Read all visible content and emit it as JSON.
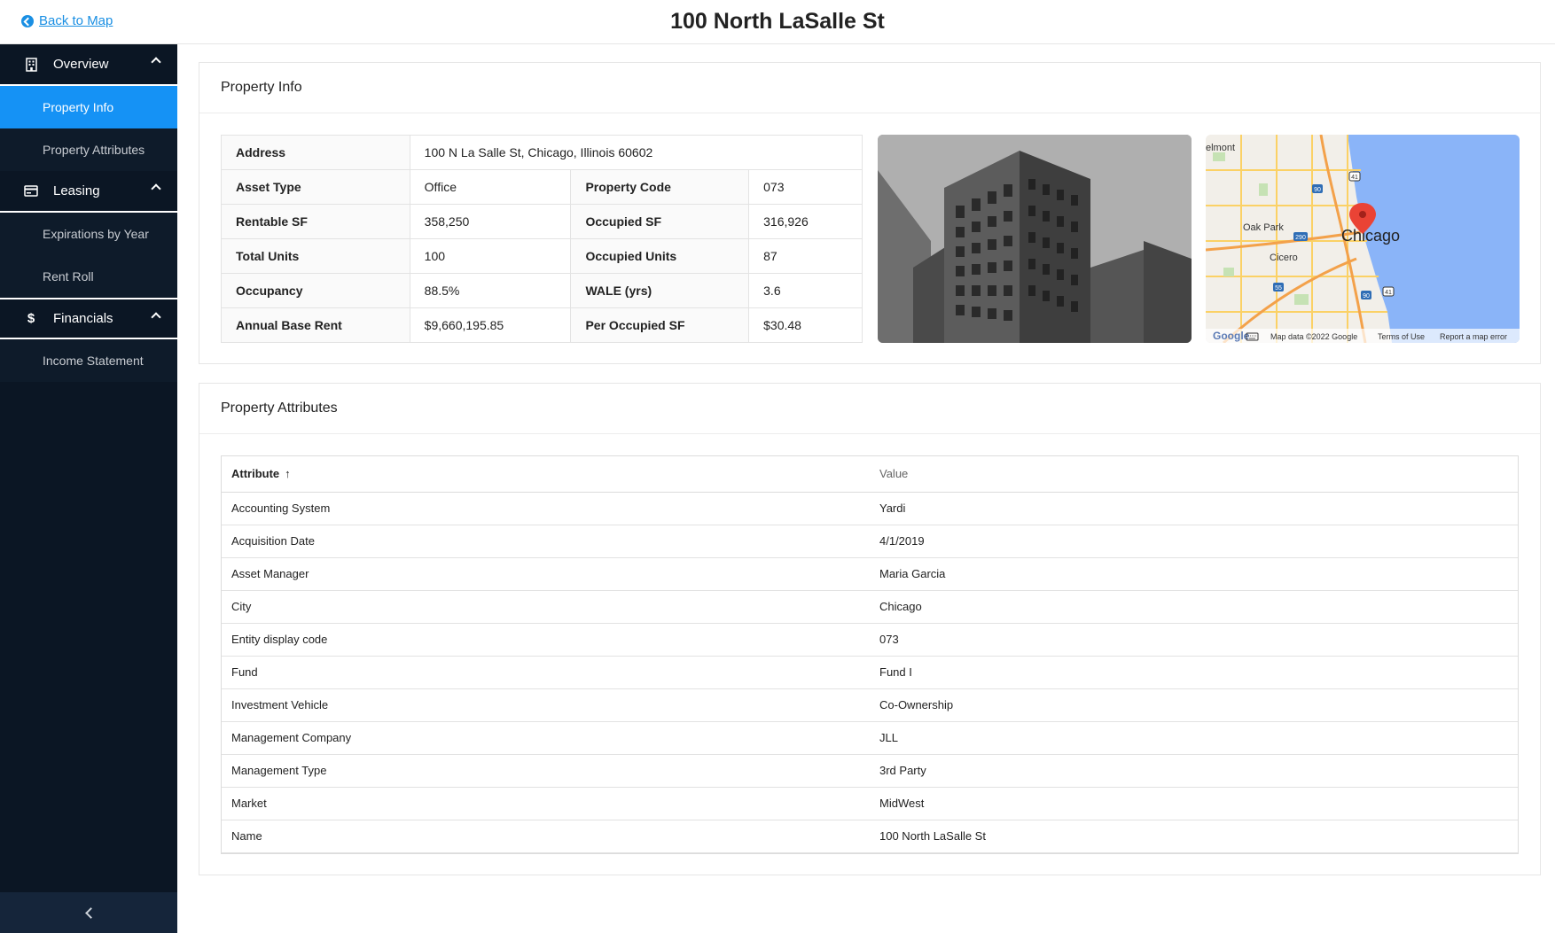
{
  "header": {
    "back_label": "Back to Map",
    "title": "100 North LaSalle St"
  },
  "sidebar": {
    "groups": [
      {
        "label": "Overview",
        "icon": "building-icon",
        "items": [
          {
            "label": "Property Info",
            "active": true
          },
          {
            "label": "Property Attributes"
          }
        ]
      },
      {
        "label": "Leasing",
        "icon": "card-icon",
        "items": [
          {
            "label": "Expirations by Year"
          },
          {
            "label": "Rent Roll"
          }
        ]
      },
      {
        "label": "Financials",
        "icon": "dollar-icon",
        "items": [
          {
            "label": "Income Statement"
          }
        ]
      }
    ]
  },
  "property_info": {
    "heading": "Property Info",
    "address_label": "Address",
    "address_value": "100 N La Salle St, Chicago, Illinois 60602",
    "rows": [
      {
        "l1": "Asset Type",
        "v1": "Office",
        "l2": "Property Code",
        "v2": "073"
      },
      {
        "l1": "Rentable SF",
        "v1": "358,250",
        "l2": "Occupied SF",
        "v2": "316,926"
      },
      {
        "l1": "Total Units",
        "v1": "100",
        "l2": "Occupied Units",
        "v2": "87"
      },
      {
        "l1": "Occupancy",
        "v1": "88.5%",
        "l2": "WALE (yrs)",
        "v2": "3.6"
      },
      {
        "l1": "Annual Base Rent",
        "v1": "$9,660,195.85",
        "l2": "Per Occupied SF",
        "v2": "$30.48"
      }
    ],
    "map": {
      "labels": {
        "city": "Chicago",
        "oak_park": "Oak Park",
        "cicero": "Cicero",
        "belmont": "elmont"
      },
      "shields": [
        "90",
        "41",
        "290",
        "55",
        "90",
        "41"
      ],
      "attribution": {
        "map_data": "Map data ©2022 Google",
        "terms": "Terms of Use",
        "report": "Report a map error",
        "google": "Google"
      },
      "water_color": "#8ab4f8",
      "pin_color": "#ea4335"
    }
  },
  "property_attributes": {
    "heading": "Property Attributes",
    "col_attribute": "Attribute",
    "col_value": "Value",
    "sort_indicator": "↑",
    "rows": [
      {
        "attribute": "Accounting System",
        "value": "Yardi"
      },
      {
        "attribute": "Acquisition Date",
        "value": "4/1/2019"
      },
      {
        "attribute": "Asset Manager",
        "value": "Maria Garcia"
      },
      {
        "attribute": "City",
        "value": "Chicago"
      },
      {
        "attribute": "Entity display code",
        "value": "073"
      },
      {
        "attribute": "Fund",
        "value": "Fund I"
      },
      {
        "attribute": "Investment Vehicle",
        "value": "Co-Ownership"
      },
      {
        "attribute": "Management Company",
        "value": "JLL"
      },
      {
        "attribute": "Management Type",
        "value": "3rd Party"
      },
      {
        "attribute": "Market",
        "value": "MidWest"
      },
      {
        "attribute": "Name",
        "value": "100 North LaSalle St"
      }
    ]
  },
  "colors": {
    "accent": "#1592f5",
    "link": "#1a8fe3",
    "sidebar_bg": "#0b1624"
  }
}
